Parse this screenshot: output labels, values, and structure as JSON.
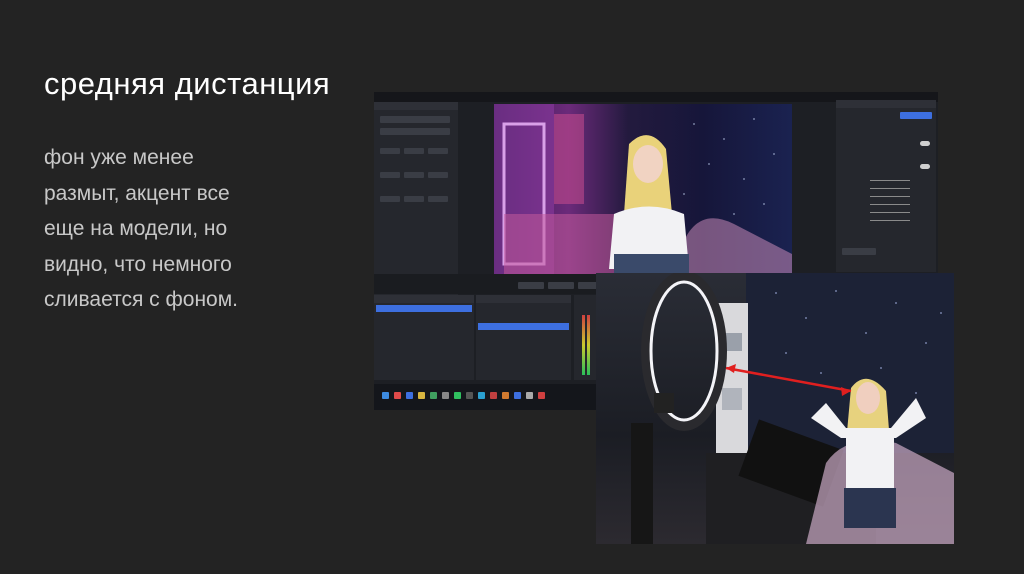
{
  "slide": {
    "title": "средняя дистанция",
    "body_lines": [
      "фон уже менее",
      "размыт, акцент все",
      "еще на модели, но",
      "видно, что немного",
      "сливается с фоном."
    ]
  },
  "colors": {
    "background": "#232323",
    "title": "#ffffff",
    "body": "#c8c8c8",
    "arrow": "#e01f1f",
    "accent": "#3d6fe0"
  },
  "app_screenshot": {
    "description_icons": [
      "obs-app-window",
      "webcam-preview",
      "windows-taskbar"
    ]
  },
  "photo": {
    "icons": [
      "ring-light",
      "red-arrow",
      "person"
    ]
  }
}
